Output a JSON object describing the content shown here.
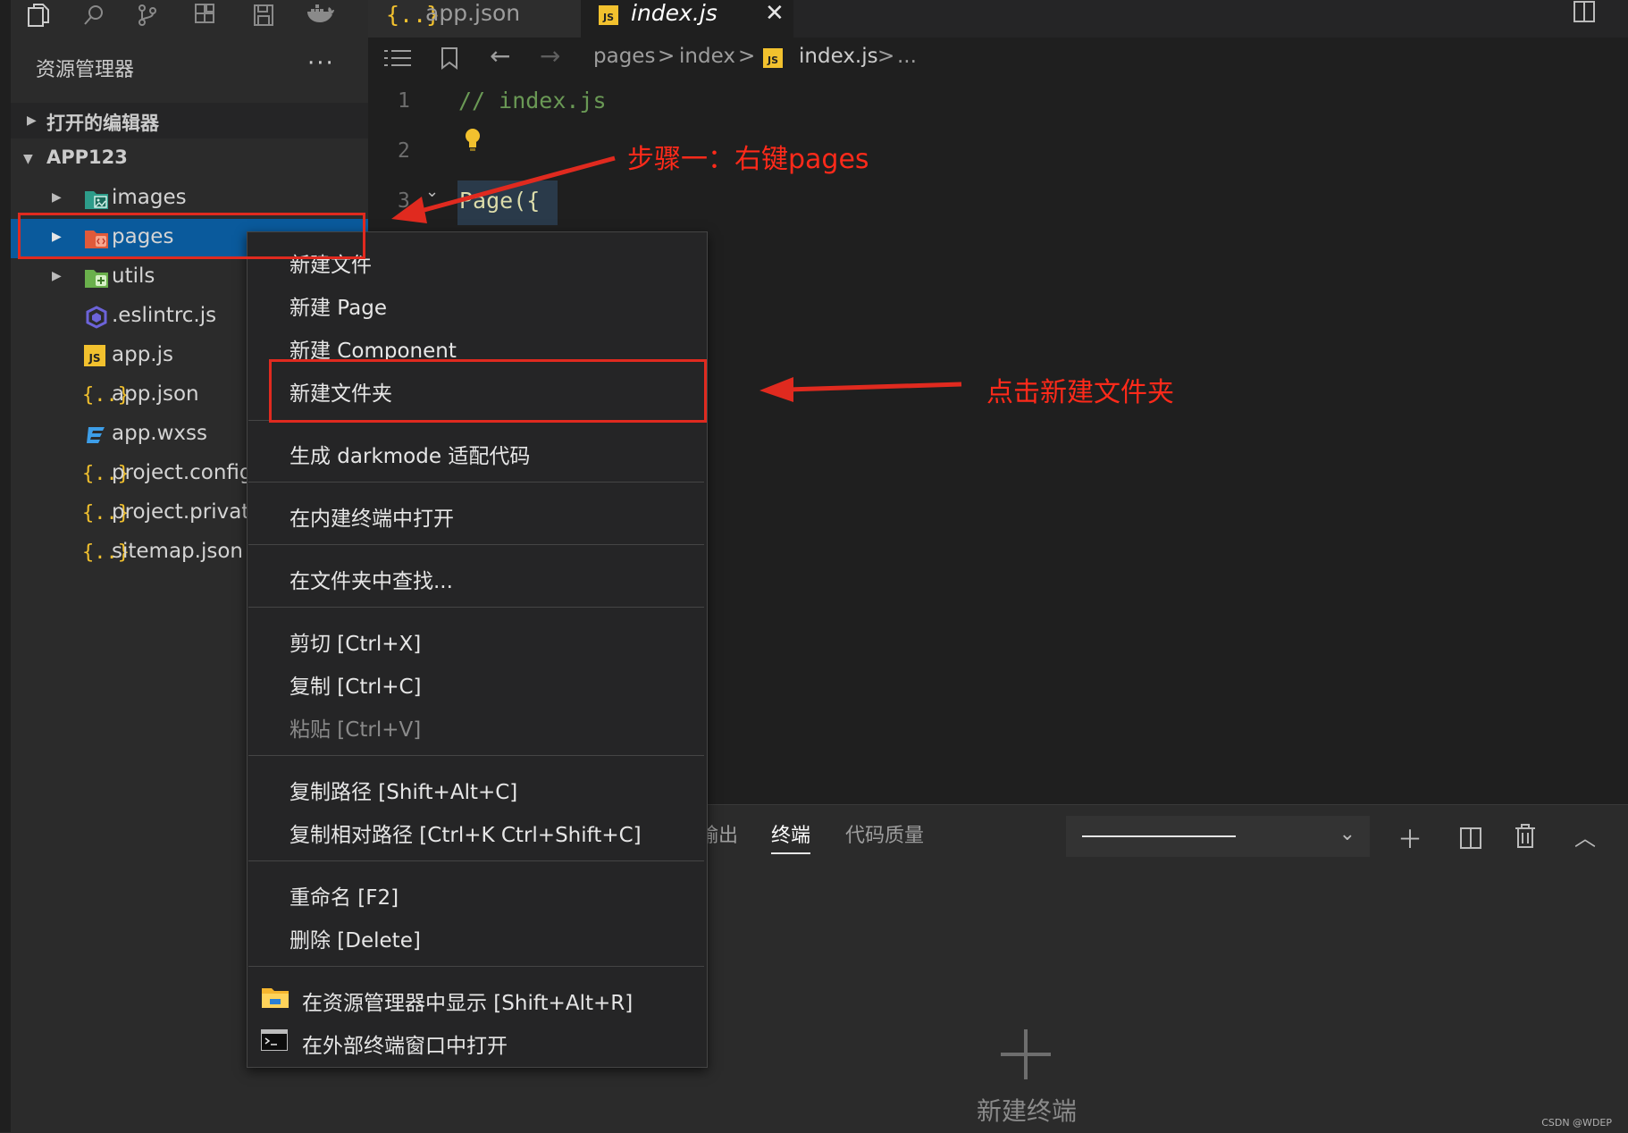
{
  "activity_icons": [
    "files-icon",
    "search-icon",
    "source-control-icon",
    "extensions-icon",
    "save-icon",
    "docker-icon"
  ],
  "tabs": [
    {
      "label": "app.json",
      "icon": "json-braces-icon"
    },
    {
      "label": "index.js",
      "icon": "js-file-icon",
      "active": true
    }
  ],
  "sidebar": {
    "title": "资源管理器",
    "more": "···",
    "sections": {
      "open_editors": "打开的编辑器",
      "project": "APP123"
    },
    "tree": [
      {
        "label": "images",
        "icon": "images-folder-icon",
        "folder": true
      },
      {
        "label": "pages",
        "icon": "pages-folder-icon",
        "folder": true,
        "selected": true
      },
      {
        "label": "utils",
        "icon": "utils-folder-icon",
        "folder": true
      },
      {
        "label": ".eslintrc.js",
        "icon": "eslint-icon"
      },
      {
        "label": "app.js",
        "icon": "js-file-icon"
      },
      {
        "label": "app.json",
        "icon": "json-braces-icon"
      },
      {
        "label": "app.wxss",
        "icon": "css-file-icon"
      },
      {
        "label": "project.config.",
        "icon": "json-braces-icon"
      },
      {
        "label": "project.private",
        "icon": "json-braces-icon"
      },
      {
        "label": "sitemap.json",
        "icon": "json-braces-icon"
      }
    ]
  },
  "breadcrumbs": [
    "pages",
    "index",
    "index.js",
    "..."
  ],
  "editor": {
    "lines": [
      {
        "no": "1",
        "text": "// index.js"
      },
      {
        "no": "2",
        "text": ""
      },
      {
        "no": "3",
        "text": "Page({"
      }
    ]
  },
  "context_menu": {
    "groups": [
      [
        "新建文件",
        "新建 Page",
        "新建 Component",
        "新建文件夹"
      ],
      [
        "生成 darkmode 适配代码"
      ],
      [
        "在内建终端中打开"
      ],
      [
        "在文件夹中查找..."
      ],
      [
        "剪切  [Ctrl+X]",
        "复制  [Ctrl+C]",
        "粘贴  [Ctrl+V]"
      ],
      [
        "复制路径  [Shift+Alt+C]",
        "复制相对路径  [Ctrl+K Ctrl+Shift+C]"
      ],
      [
        "重命名  [F2]",
        "删除  [Delete]"
      ],
      [
        "在资源管理器中显示  [Shift+Alt+R]",
        "在外部终端窗口中打开"
      ]
    ]
  },
  "panel": {
    "tabs": [
      "输出",
      "终端",
      "代码质量"
    ],
    "active_tab": "终端",
    "new_terminal": "新建终端"
  },
  "annotations": {
    "step1": "步骤一：右键pages",
    "step2": "点击新建文件夹"
  },
  "colors": {
    "annotation_red": "#e02a1f",
    "selection_blue": "#0a5a9c",
    "js_yellow": "#f2c12e"
  },
  "watermark": "CSDN @WDEP"
}
